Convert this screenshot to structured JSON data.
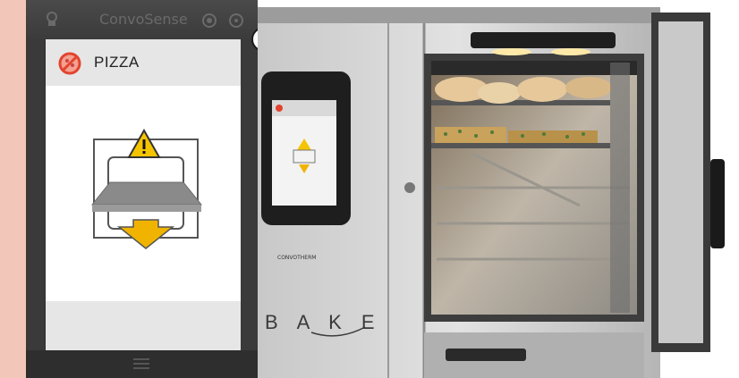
{
  "app": {
    "title": "ConvoSense"
  },
  "program": {
    "name": "PIZZA",
    "icon": "no-pizza-icon"
  },
  "diagram": {
    "icons": [
      "oven-frame-icon",
      "warning-icon",
      "tray-icon",
      "down-arrow-icon"
    ]
  },
  "controls": {
    "close_icon": "close-icon",
    "home_icon": "home-icon",
    "settings_icon": "settings-icon",
    "help_icon": "help-icon",
    "menu_icon": "menu-icon"
  },
  "oven": {
    "brand_text": "BAKE"
  },
  "colors": {
    "backdrop": "#f2c7b9",
    "warning": "#f5c400",
    "arrow": "#f0b400",
    "no_icon": "#e2442f"
  }
}
